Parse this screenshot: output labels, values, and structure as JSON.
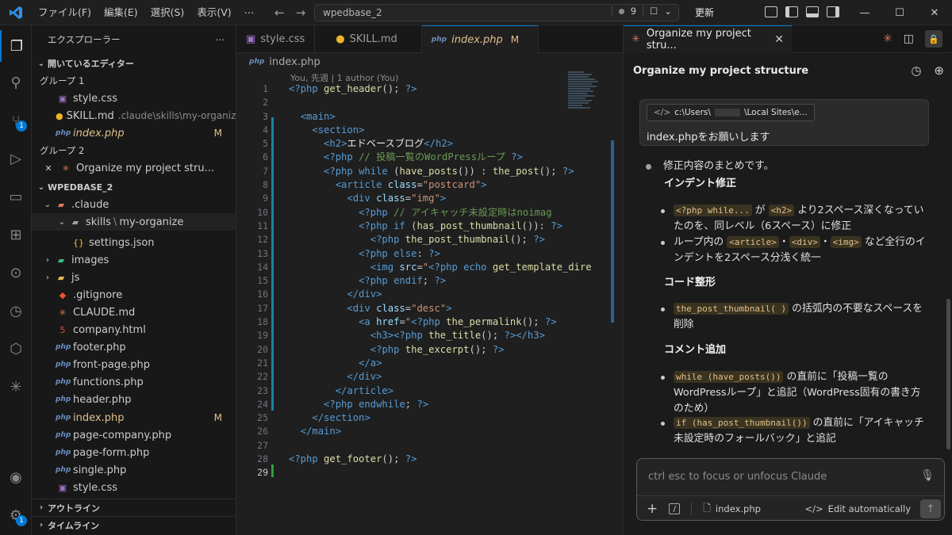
{
  "titlebar": {
    "menus": [
      "ファイル(F)",
      "編集(E)",
      "選択(S)",
      "表示(V)",
      "⋯"
    ],
    "search_value": "wpedbase_2",
    "badge_count": "9",
    "update_label": "更新"
  },
  "activity": {
    "scm_badge": "1",
    "settings_badge": "1"
  },
  "sidebar": {
    "title": "エクスプローラー",
    "open_editors_label": "開いているエディター",
    "group1_label": "グループ 1",
    "group1_items": [
      {
        "name": "style.css",
        "desc": "",
        "mod": ""
      },
      {
        "name": "SKILL.md",
        "desc": ".claude\\skills\\my-organize",
        "mod": ""
      },
      {
        "name": "index.php",
        "desc": "",
        "mod": "M"
      }
    ],
    "group2_label": "グループ 2",
    "group2_items": [
      {
        "name": "Organize my project stru..."
      }
    ],
    "workspace_label": "WPEDBASE_2",
    "tree": [
      {
        "name": ".claude"
      },
      {
        "name": "skills",
        "sep": "\\",
        "sub": "my-organize"
      },
      {
        "name": "settings.json"
      },
      {
        "name": "images"
      },
      {
        "name": "js"
      },
      {
        "name": ".gitignore"
      },
      {
        "name": "CLAUDE.md"
      },
      {
        "name": "company.html"
      },
      {
        "name": "footer.php"
      },
      {
        "name": "front-page.php"
      },
      {
        "name": "functions.php"
      },
      {
        "name": "header.php"
      },
      {
        "name": "index.php",
        "mod": "M"
      },
      {
        "name": "page-company.php"
      },
      {
        "name": "page-form.php"
      },
      {
        "name": "single.php"
      },
      {
        "name": "style.css"
      }
    ],
    "outline_label": "アウトライン",
    "timeline_label": "タイムライン"
  },
  "editor": {
    "tabs": [
      {
        "label": "style.css"
      },
      {
        "label": "SKILL.md"
      },
      {
        "label": "index.php",
        "mod": "M"
      }
    ],
    "breadcrumb": "index.php",
    "blame": "You, 先週 | 1 author (You)",
    "line_numbers": [
      "1",
      "2",
      "3",
      "4",
      "5",
      "6",
      "7",
      "8",
      "9",
      "10",
      "11",
      "12",
      "13",
      "14",
      "15",
      "16",
      "17",
      "18",
      "19",
      "20",
      "21",
      "22",
      "23",
      "24",
      "25",
      "26",
      "27",
      "28",
      "29"
    ]
  },
  "panel": {
    "tab_label": "Organize my project stru...",
    "title": "Organize my project structure",
    "context_chip_prefix": "c:\\Users\\",
    "context_chip_suffix": "\\Local Sites\\e...",
    "user_message": "index.phpをお願いします",
    "reply": {
      "intro": "修正内容のまとめです。",
      "h1": "インデント修正",
      "h1_items": [
        {
          "code1": "<?php while...",
          "mid": " が ",
          "code2": "<h2>",
          "text": " より2スペース深くなっていたのを、同レベル（6スペース）に修正"
        },
        {
          "text_pre": "ループ内の ",
          "code1": "<article>",
          "dot1": "・",
          "code2": "<div>",
          "dot2": "・",
          "code3": "<img>",
          "text": " など全行のインデントを2スペース分浅く統一"
        }
      ],
      "h2": "コード整形",
      "h2_items": [
        {
          "code1": "the_post_thumbnail( )",
          "text": " の括弧内の不要なスペースを削除"
        }
      ],
      "h3": "コメント追加",
      "h3_items": [
        {
          "code1": "while (have_posts())",
          "text": " の直前に「投稿一覧のWordPressループ」と追記（WordPress固有の書き方のため）"
        },
        {
          "code1": "if (has_post_thumbnail())",
          "text": " の直前に「アイキャッチ未設定時のフォールバック」と追記"
        }
      ]
    },
    "input_placeholder": "ctrl esc to focus or unfocus Claude",
    "attached_file": "index.php",
    "edit_mode": "Edit automatically"
  }
}
